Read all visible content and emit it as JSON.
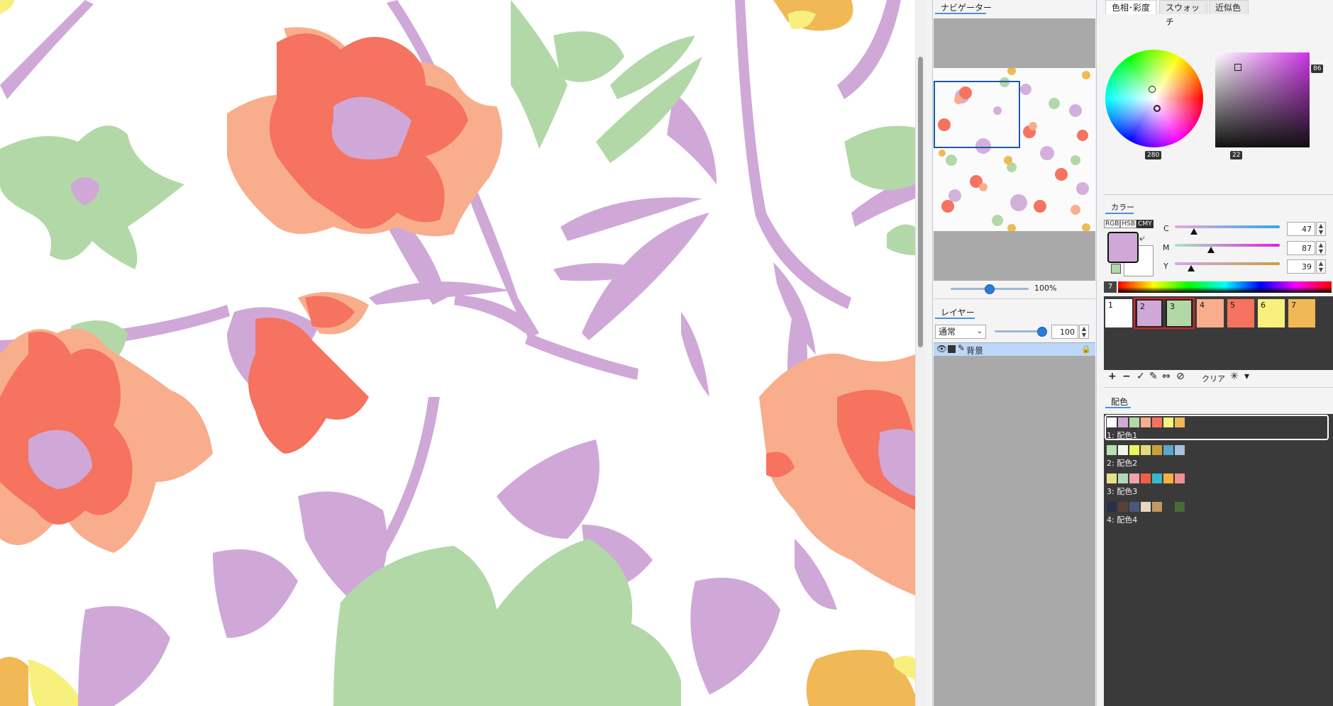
{
  "navigator": {
    "tab": "ナビゲーター",
    "zoom": "100%"
  },
  "layers": {
    "tab": "レイヤー",
    "blend_mode": "通常",
    "opacity": "100",
    "layer_name": "背景"
  },
  "color_tabs": [
    "色相･彩度",
    "スウォッチ",
    "近似色"
  ],
  "hue_saturation": {
    "hue_value": "280",
    "sat_value": "22",
    "bright_value": "86"
  },
  "color": {
    "section": "カラー",
    "modes": [
      "RGB",
      "HSB",
      "CMY"
    ],
    "active_mode": "CMY",
    "sliders": [
      {
        "label": "C",
        "value": "47"
      },
      {
        "label": "M",
        "value": "87"
      },
      {
        "label": "Y",
        "value": "39"
      }
    ],
    "fg": "#cfa8d8",
    "bg": "#ffffff",
    "small": "#b2d8a8"
  },
  "palette": {
    "index_label": "7",
    "swatches": [
      {
        "num": "1",
        "color": "#ffffff"
      },
      {
        "num": "2",
        "color": "#cfa8d8"
      },
      {
        "num": "3",
        "color": "#b2d8a8"
      },
      {
        "num": "4",
        "color": "#f8ae8c"
      },
      {
        "num": "5",
        "color": "#f5735f"
      },
      {
        "num": "6",
        "color": "#f7f07c"
      },
      {
        "num": "7",
        "color": "#f0b955"
      }
    ],
    "toolbar": {
      "add": "+",
      "remove": "−",
      "check": "✓",
      "pen": "✎",
      "swap": "⇔",
      "cancel": "⊘",
      "clear": "クリア",
      "star": "✳",
      "menu": "▾"
    }
  },
  "scheme": {
    "section": "配色",
    "items": [
      {
        "label": "1: 配色1",
        "colors": [
          "#ffffff",
          "#cfa8d8",
          "#b2d8a8",
          "#f8ae8c",
          "#f5735f",
          "#f7f07c",
          "#f0b955"
        ]
      },
      {
        "label": "2: 配色2",
        "colors": [
          "#b8e0b0",
          "#f0f8e8",
          "#ecf560",
          "#e8d87a",
          "#c8a040",
          "#5aa8c8",
          "#a8c0e0"
        ]
      },
      {
        "label": "3: 配色3",
        "colors": [
          "#e8e088",
          "#b0d8b8",
          "#f2a0b0",
          "#f06040",
          "#38b8c8",
          "#f8b040",
          "#f09090"
        ]
      },
      {
        "label": "4: 配色4",
        "colors": [
          "#283050",
          "#5a4038",
          "#485878",
          "#e8d8c0",
          "#c09860",
          "#3a3a3a",
          "#4a6a38"
        ]
      }
    ]
  }
}
